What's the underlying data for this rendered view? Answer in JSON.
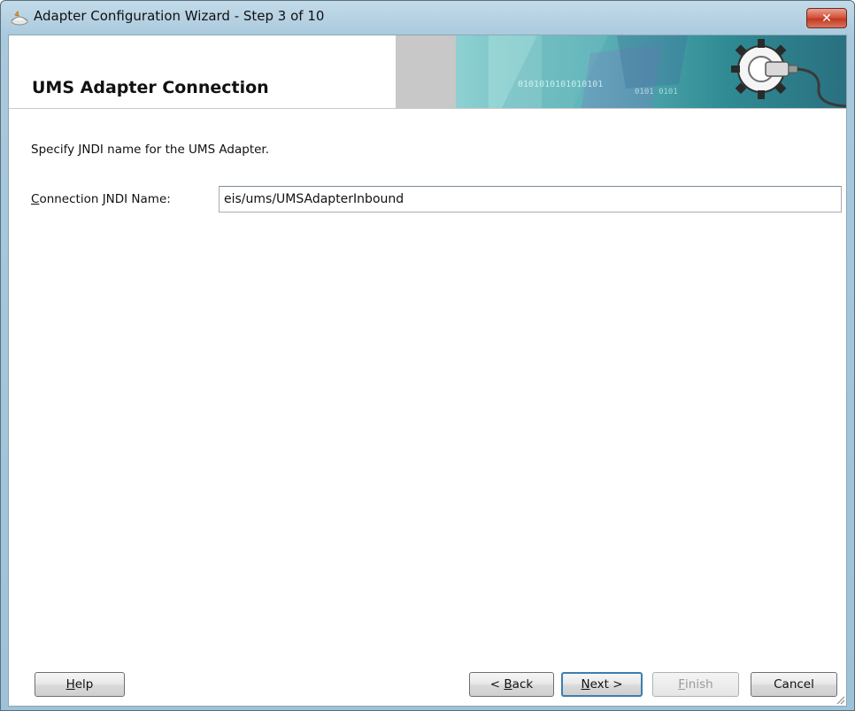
{
  "window": {
    "title": "Adapter Configuration Wizard - Step 3 of 10",
    "icon": "wizard-app-icon",
    "close_glyph": "✕"
  },
  "header": {
    "title": "UMS Adapter Connection",
    "banner_icon": "gear-plug-icon"
  },
  "content": {
    "description": "Specify JNDI name for the UMS Adapter.",
    "field": {
      "label_mnemonic": "C",
      "label_rest": "onnection JNDI Name:",
      "value": "eis/ums/UMSAdapterInbound"
    }
  },
  "buttons": {
    "help_mnemonic": "H",
    "help_rest": "elp",
    "back_prefix": "< ",
    "back_mnemonic": "B",
    "back_rest": "ack",
    "next_mnemonic": "N",
    "next_rest": "ext >",
    "finish_mnemonic": "F",
    "finish_rest": "inish",
    "cancel_label": "Cancel"
  },
  "colors": {
    "banner_teal": "#3f8f96",
    "banner_gray": "#c8c8c8",
    "primary_border": "#3c7fb1",
    "close_red": "#c23a22"
  }
}
